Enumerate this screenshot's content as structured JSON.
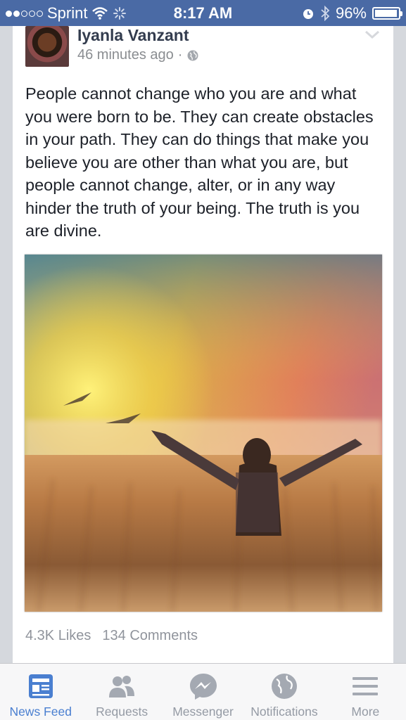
{
  "status_bar": {
    "carrier": "Sprint",
    "time": "8:17 AM",
    "battery_percent": "96%",
    "battery_level": 0.96,
    "signal_bars_filled": 2,
    "signal_bars_total": 5
  },
  "post": {
    "author": "Iyanla Vanzant",
    "timestamp": "46 minutes ago",
    "separator": "·",
    "privacy_icon": "globe-icon",
    "text": "People cannot change who you are and what you were born to be. They can create obstacles in your path. They can do things that make you believe you are other than what you are, but people cannot change, alter, or in any way hinder the truth of your being. The truth is you are divine.",
    "likes": "4.3K Likes",
    "comments": "134 Comments"
  },
  "tab_bar": {
    "tabs": [
      {
        "label": "News Feed",
        "icon": "news-feed-icon",
        "active": true
      },
      {
        "label": "Requests",
        "icon": "friend-requests-icon",
        "active": false
      },
      {
        "label": "Messenger",
        "icon": "messenger-icon",
        "active": false
      },
      {
        "label": "Notifications",
        "icon": "globe-notifications-icon",
        "active": false
      },
      {
        "label": "More",
        "icon": "menu-icon",
        "active": false
      }
    ]
  },
  "colors": {
    "status_bar": "#4a6aa5",
    "active_tab": "#4a7fd0",
    "inactive_tab": "#949aa4"
  }
}
